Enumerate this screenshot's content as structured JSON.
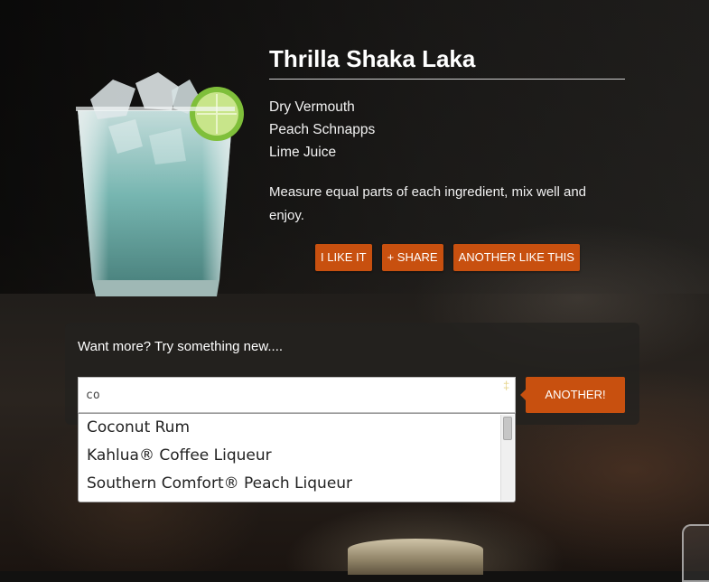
{
  "drink": {
    "name": "Thrilla Shaka Laka",
    "ingredients": [
      "Dry Vermouth",
      "Peach Schnapps",
      "Lime Juice"
    ],
    "instructions": "Measure equal parts of each ingredient, mix well and enjoy."
  },
  "actions": {
    "like": "I LIKE IT",
    "share": "+ SHARE",
    "another_like": "ANOTHER LIKE THIS"
  },
  "search": {
    "prompt": "Want more? Try something new....",
    "value": "co",
    "button": "ANOTHER!",
    "suggestions": [
      "Coconut Rum",
      "Kahlua® Coffee Liqueur",
      "Southern Comfort® Peach Liqueur"
    ]
  },
  "icons": {
    "clear": "clear-input-icon",
    "drink_image": "cocktail-glass-image"
  },
  "colors": {
    "accent": "#c8500f",
    "text": "#ffffff"
  }
}
